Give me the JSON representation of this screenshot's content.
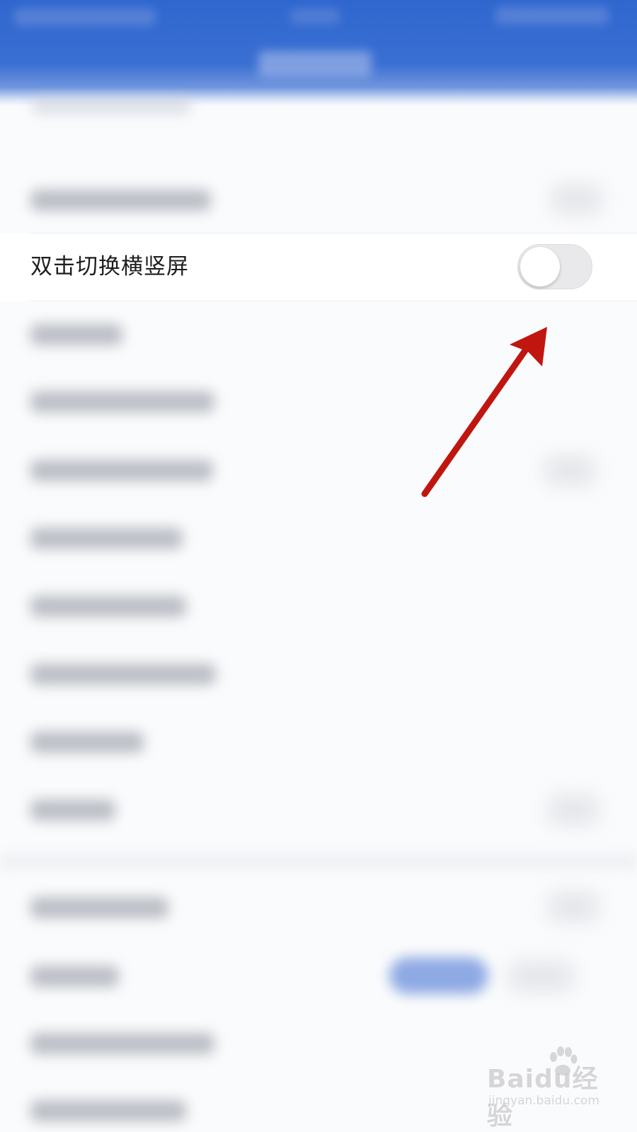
{
  "settings": {
    "focus_row": {
      "label": "双击切换横竖屏",
      "toggle_on": false
    }
  },
  "annotation": {
    "arrow_color": "#c0160f"
  },
  "watermark": {
    "brand": "Baidu经验",
    "url": "jingyan.baidu.com"
  },
  "colors": {
    "header": "#2f67cf",
    "toggle_off_track": "#e9e9eb"
  }
}
